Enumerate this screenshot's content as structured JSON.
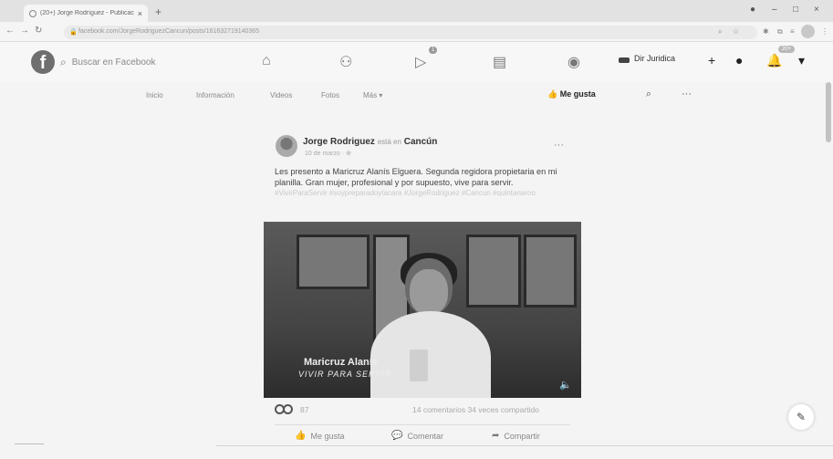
{
  "browser": {
    "tab_title": "(20+) Jorge Rodríguez - Publicac",
    "tab_close": "×",
    "new_tab": "+",
    "url": "facebook.com/JorgeRodriguezCancun/posts/161632719140365",
    "back": "←",
    "forward": "→",
    "reload": "↻",
    "win_min": "–",
    "win_max": "□",
    "win_close": "×"
  },
  "facebook": {
    "logo": "f",
    "search_placeholder": "Buscar en Facebook",
    "watch_badge": "1",
    "page_name": "Dir Juridica",
    "notifications_badge": "20+"
  },
  "page_tabs": {
    "items": [
      "Inicio",
      "Información",
      "Videos",
      "Fotos",
      "Más ▾"
    ],
    "like_button": "Me gusta",
    "more": "···"
  },
  "post": {
    "author": "Jorge Rodriguez",
    "is_in": "está en",
    "location": "Cancún",
    "time": "10 de marzo · ⊕",
    "more": "···",
    "text": "Les presento a Maricruz Alanís Elguera. Segunda regidora propietaria en mi planilla. Gran mujer, profesional y por supuesto, vive para servir.",
    "hashtags": "#VivirParaServir #soypreparadoytacara #JorgeRodriguez #Cancun #quintanaroo",
    "video": {
      "name_overlay": "Maricruz Alanís",
      "tagline_overlay": "VIVIR PARA SERVIR",
      "volume_icon": "🔈"
    },
    "reactions_count": "87",
    "comments_shares": "14 comentarios  34 veces compartido",
    "actions": {
      "like": "Me gusta",
      "comment": "Comentar",
      "share": "Compartir"
    }
  },
  "icons": {
    "home": "home-icon",
    "friends": "friends-icon",
    "watch": "watch-icon",
    "marketplace": "marketplace-icon",
    "groups": "groups-icon",
    "create": "plus-icon",
    "messenger": "messenger-icon",
    "notifications": "bell-icon",
    "account": "chevron-down-icon"
  }
}
